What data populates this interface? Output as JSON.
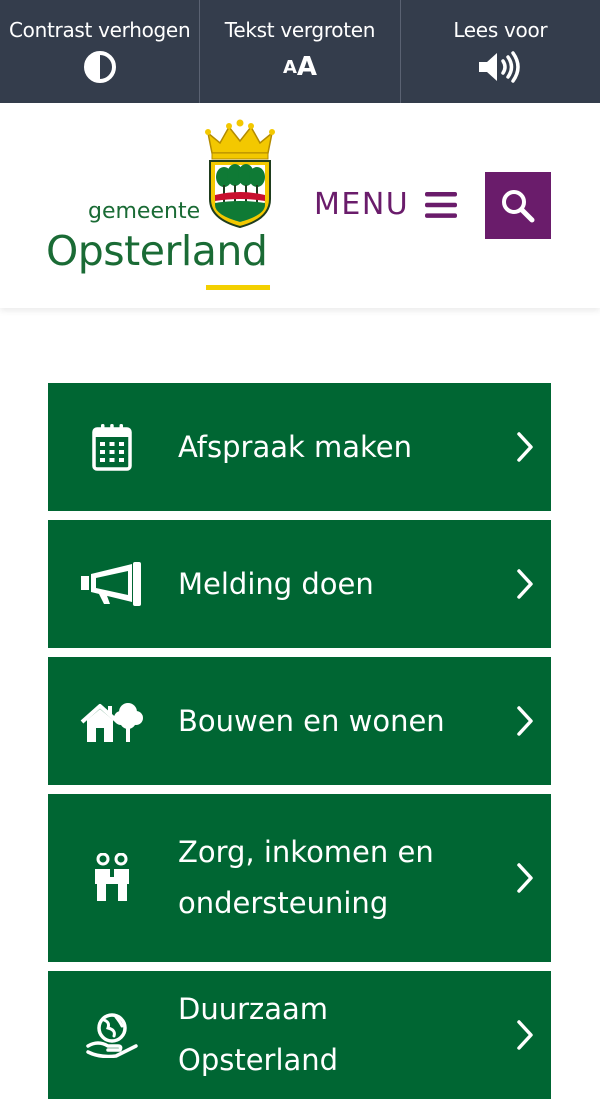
{
  "accessibility": {
    "contrast_label": "Contrast verhogen",
    "text_label": "Tekst vergroten",
    "text_icon_small": "A",
    "text_icon_large": "A",
    "read_label": "Lees voor",
    "icons": [
      "contrast-icon",
      "text-size-icon",
      "speaker-icon"
    ]
  },
  "header": {
    "logo_small": "gemeente",
    "logo_big": "Opsterland",
    "menu_label": "MENU",
    "colors": {
      "brand_green": "#006633",
      "accent_purple": "#6a1c6b",
      "toolbar_bg": "#343d4c",
      "underline_yellow": "#f3d000"
    }
  },
  "tiles": [
    {
      "label": "Afspraak maken",
      "icon": "calendar-icon"
    },
    {
      "label": "Melding doen",
      "icon": "megaphone-icon"
    },
    {
      "label": "Bouwen en wonen",
      "icon": "house-tree-icon"
    },
    {
      "label": "Zorg, inkomen en ondersteuning",
      "icon": "care-people-icon"
    },
    {
      "label": "Duurzaam Opsterland",
      "icon": "globe-hand-icon"
    }
  ]
}
